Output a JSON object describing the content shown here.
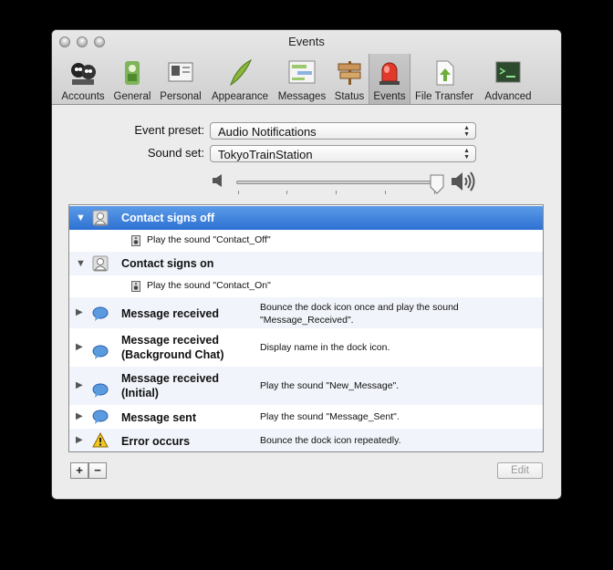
{
  "window": {
    "title": "Events"
  },
  "toolbar": {
    "items": [
      {
        "label": "Accounts",
        "icon": "accounts-icon"
      },
      {
        "label": "General",
        "icon": "general-icon"
      },
      {
        "label": "Personal",
        "icon": "personal-icon"
      },
      {
        "label": "Appearance",
        "icon": "appearance-icon"
      },
      {
        "label": "Messages",
        "icon": "messages-icon"
      },
      {
        "label": "Status",
        "icon": "status-icon"
      },
      {
        "label": "Events",
        "icon": "events-icon",
        "selected": true
      },
      {
        "label": "File Transfer",
        "icon": "file-transfer-icon"
      },
      {
        "label": "Advanced",
        "icon": "advanced-icon"
      }
    ]
  },
  "form": {
    "event_preset_label": "Event preset:",
    "event_preset_value": "Audio Notifications",
    "sound_set_label": "Sound set:",
    "sound_set_value": "TokyoTrainStation",
    "volume_level": 0.95
  },
  "events": [
    {
      "name": "Contact signs off",
      "expanded": true,
      "selected": true,
      "icon": "contact-icon",
      "sub": "Play the sound \"Contact_Off\""
    },
    {
      "name": "Contact signs on",
      "expanded": true,
      "icon": "contact-icon",
      "sub": "Play the sound \"Contact_On\""
    },
    {
      "name": "Message received",
      "icon": "message-bubble-icon",
      "desc": "Bounce the dock icon once and play the sound \"Message_Received\"."
    },
    {
      "name": "Message received\n(Background Chat)",
      "icon": "message-bubble-icon",
      "desc": "Display name in the dock icon."
    },
    {
      "name": "Message received\n(Initial)",
      "icon": "message-bubble-icon",
      "desc": "Play the sound \"New_Message\"."
    },
    {
      "name": "Message sent",
      "icon": "message-bubble-icon",
      "desc": "Play the sound \"Message_Sent\"."
    },
    {
      "name": "Error occurs",
      "icon": "warning-icon",
      "desc": "Bounce the dock icon repeatedly."
    }
  ],
  "buttons": {
    "add": "+",
    "remove": "−",
    "edit": "Edit"
  }
}
